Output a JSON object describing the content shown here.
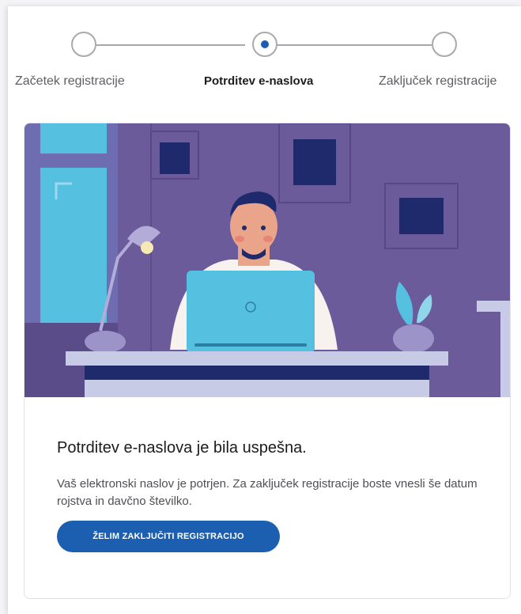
{
  "stepper": {
    "steps": [
      {
        "label": "Začetek registracije",
        "state": "inactive"
      },
      {
        "label": "Potrditev e-naslova",
        "state": "active"
      },
      {
        "label": "Zaključek registracije",
        "state": "inactive"
      }
    ]
  },
  "card": {
    "heading": "Potrditev e-naslova je bila uspešna.",
    "description": "Vaš elektronski naslov je potrjen. Za zaključek registracije boste vnesli še datum rojstva in davčno številko.",
    "cta_label": "ŽELIM ZAKLJUČITI REGISTRACIJO"
  },
  "colors": {
    "accent": "#1c5fb1",
    "illustration_background": "#6b5b9a"
  }
}
